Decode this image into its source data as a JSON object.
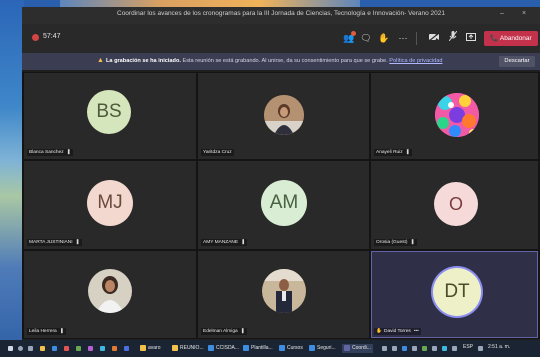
{
  "window": {
    "title": "Coordinar los avances de los cronogramas para la III Jornada de Ciencias, Tecnología e Innovación- Verano 2021",
    "minimize": "–",
    "close": "×"
  },
  "toolbar": {
    "timer": "57:47",
    "leave_label": "Abandonar",
    "icons": [
      "participants-icon",
      "chat-icon",
      "raise-hand-icon",
      "more-icon",
      "camera-icon",
      "mic-icon",
      "share-icon"
    ]
  },
  "banner": {
    "bold": "La grabación se ha iniciado.",
    "text": " Esta reunión se está grabando. Al unirse, da su consentimiento para que se grabe.",
    "link": "Política de privacidad",
    "dismiss_label": "Descartar"
  },
  "participants": [
    {
      "name": "Blanca Sanchez",
      "initials": "BS",
      "kind": "initials",
      "avatar_color": "#d6e6bc",
      "text_color": "#4d5b3b"
    },
    {
      "name": "Yaritdza Cruz",
      "initials": "",
      "kind": "photo"
    },
    {
      "name": "Anayeli Ruiz",
      "initials": "",
      "kind": "art"
    },
    {
      "name": "MARTA JUSTINIANI",
      "initials": "MJ",
      "kind": "initials",
      "avatar_color": "#f2d8cf",
      "text_color": "#6b4a3c"
    },
    {
      "name": "AMY MANZANE",
      "initials": "AM",
      "kind": "initials",
      "avatar_color": "#d9ecd4",
      "text_color": "#486141"
    },
    {
      "name": "Orosia (Guest)",
      "initials": "O",
      "kind": "initials",
      "avatar_color": "#f6dada",
      "text_color": "#7a3d3d"
    },
    {
      "name": "Leila Herrera",
      "initials": "",
      "kind": "photo"
    },
    {
      "name": "Edelman Almiga",
      "initials": "",
      "kind": "photo"
    },
    {
      "name": "David Torres",
      "initials": "DT",
      "kind": "initials",
      "avatar_color": "#eef0c8",
      "text_color": "#4b4d2a",
      "speaking": true,
      "extra": "•••"
    }
  ],
  "taskbar": {
    "items": [
      "avaro",
      "REUNIO...",
      "CCISDA...",
      "Plantilla...",
      "Cursos",
      "Seguri...",
      "Coordi..."
    ],
    "time": "2:51 a. m.",
    "lang": "ESP"
  }
}
